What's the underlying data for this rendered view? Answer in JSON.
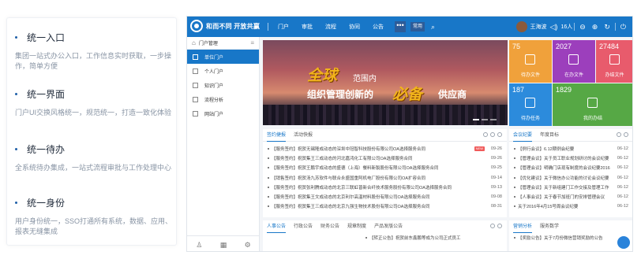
{
  "features": [
    {
      "title": "统一入口",
      "desc": "集团一站式办公入口，工作信息实时获取，一步操作，简单方便"
    },
    {
      "title": "统一界面",
      "desc": "门户UI交换风格统一，规范统一，打造一致化体验"
    },
    {
      "title": "统一待办",
      "desc": "全系统待办集成，一站式流程审批与工作处理中心"
    },
    {
      "title": "统一身份",
      "desc": "用户身份统一，SSO打通所有系统，数据、应用、报表无缝集成"
    }
  ],
  "app": {
    "brand": "和而不同 开放共赢",
    "nav": [
      "门户",
      "审批",
      "流程",
      "协同",
      "公告"
    ],
    "more_label": "•••",
    "common_label": "常用",
    "search_icon": "search-icon",
    "user_name": "王海波",
    "online": "16人",
    "sidebar": {
      "header": "门户管理",
      "items": [
        "单位门户",
        "个人门户",
        "知识门户",
        "流程分析",
        "网站门户"
      ],
      "active_index": 0
    },
    "banner": {
      "gold1": "全球",
      "line1": "范围内",
      "line2": "组织管理创新的",
      "gold2": "必备",
      "line3": "供应商"
    },
    "tiles": [
      {
        "num": "75",
        "label": "待办文件",
        "color": "#f0a13b"
      },
      {
        "num": "2027",
        "label": "在办文件",
        "color": "#9c3fbc"
      },
      {
        "num": "27484",
        "label": "办结文件",
        "color": "#e85b6c"
      },
      {
        "num": "187",
        "label": "待办任务",
        "color": "#2c8bdc"
      },
      {
        "num": "1829",
        "label": "我的办结",
        "color": "#56a845"
      }
    ],
    "news": {
      "tabs": [
        "签约捷报",
        "活动快报"
      ],
      "rows": [
        {
          "text": "【服务签约】祝贺无锡隆成动态的深圳中冠智科技股份有限公司OA选择服务合同",
          "date": "09-26",
          "new": true
        },
        {
          "text": "【服务签约】祝贺集王三成动态的河北嘉鸿化工有限公司OA选择服务合同",
          "date": "09-26",
          "new": false
        },
        {
          "text": "【服务签约】祝贺王鹏宇成动态的盛德（上海）餐料新製股份有限公司OA选择服务合同",
          "date": "09-25",
          "new": false
        },
        {
          "text": "【销售签约】祝贺汤九苏软件与联合永盛国重阿机电厂股份有限公司OA扩容合同",
          "date": "09-14",
          "new": false
        },
        {
          "text": "【服务签约】祝贺张利腾成动态的北京三联虹普新合纤技术服务股份有限公司OA选择服务合同",
          "date": "09-13",
          "new": false
        },
        {
          "text": "【服务签约】祝贺集王文成动态的北京利尔高温材料股份有限公司OA选择服务合同",
          "date": "09-08",
          "new": false
        },
        {
          "text": "【服务签约】祝贺集王三成动态的北京九强生物技术股份有限公司OA选择服务合同",
          "date": "08-31",
          "new": false
        }
      ]
    },
    "meetings": {
      "tabs": [
        "会议纪要",
        "年度目标"
      ],
      "rows": [
        {
          "text": "【例行会议】6.12期例会纪要",
          "date": "06-12"
        },
        {
          "text": "【管理会议】关于员工职业规划研讨的会议纪要",
          "date": "06-12"
        },
        {
          "text": "【管理会议】明确门店现有制度的会议纪要2016",
          "date": "06-12"
        },
        {
          "text": "【优化建议】关于微信办公功能的讨论会议纪要",
          "date": "06-12"
        },
        {
          "text": "【管理会议】关于新组建门工作交接及管理工作",
          "date": "06-12"
        },
        {
          "text": "【人事会议】关于春节加班门的安排管理会议",
          "date": "06-12"
        },
        {
          "text": "关于2016年4月15号周会议纪要",
          "date": "06-12"
        }
      ]
    },
    "bottom_left_tabs": [
      "人事公告",
      "行政公告",
      "财务公告",
      "规章制度",
      "产品发版公告"
    ],
    "bottom_mid_row": "【转正公告】祝贺前东鑫鹏等成为公司正式员工",
    "bottom_right_tabs": [
      "营销分析",
      "服务数学"
    ],
    "bottom_right_row": "【奖励公告】关于7月份微信营销奖励的公告"
  }
}
